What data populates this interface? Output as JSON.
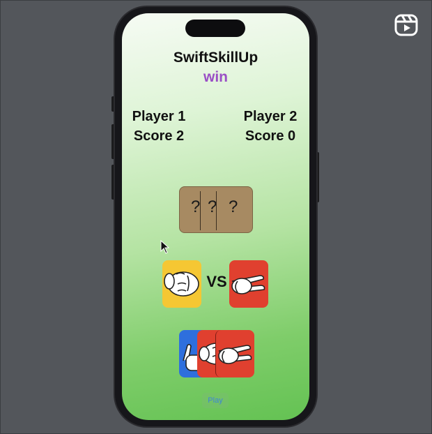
{
  "app": {
    "title": "SwiftSkillUp",
    "result": "win"
  },
  "players": [
    {
      "name": "Player 1",
      "score_label": "Score 2"
    },
    {
      "name": "Player 2",
      "score_label": "Score 0"
    }
  ],
  "mystery_card": {
    "marks": [
      "?",
      "?",
      "?"
    ]
  },
  "versus": {
    "label": "VS",
    "player_choice": "rock",
    "opponent_choice": "scissors"
  },
  "hand_choices": [
    "paper",
    "rock",
    "scissors"
  ],
  "play_button": {
    "label": "Play"
  },
  "colors": {
    "background": "#53565b",
    "title": "#111111",
    "result": "#9a4fc5",
    "card_yellow": "#f5c733",
    "card_red": "#e0402f",
    "card_blue": "#2e6fdd",
    "card_brown": "#a78a62",
    "button_text": "#3e86d6"
  },
  "icons": [
    "reels-icon",
    "cursor-icon",
    "rock-hand-icon",
    "scissors-hand-icon",
    "paper-hand-icon"
  ]
}
